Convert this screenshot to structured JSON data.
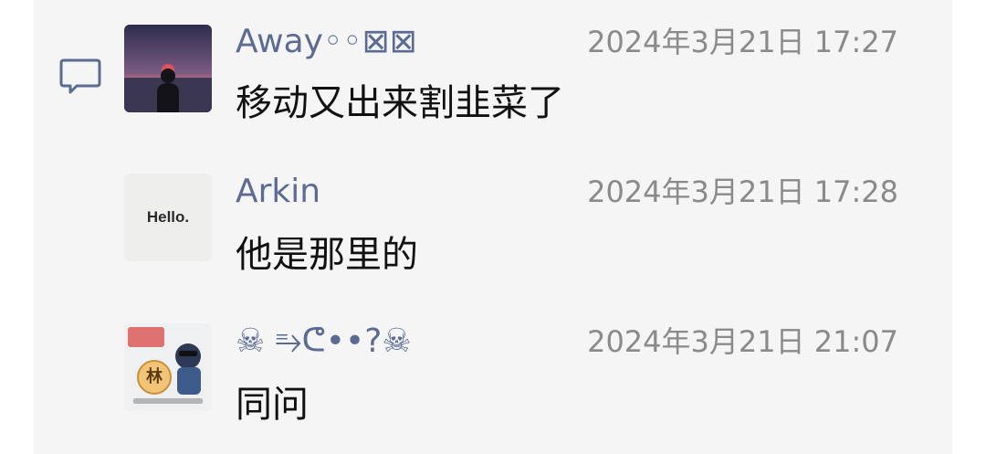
{
  "comments": [
    {
      "author": "Away◦◦⊠⊠",
      "timestamp": "2024年3月21日 17:27",
      "text": "移动又出来割韭菜了"
    },
    {
      "author": "Arkin",
      "timestamp": "2024年3月21日 17:28",
      "text": "他是那里的",
      "avatar_text": "Hello."
    },
    {
      "author": "☠ ⥱ᕦ••?☠",
      "timestamp": "2024年3月21日 21:07",
      "text": "同问",
      "avatar_text": "林"
    }
  ],
  "colors": {
    "author": "#5b6b92",
    "timestamp": "#8a8a8a",
    "message": "#111111",
    "panel_bg": "#f5f5f5",
    "icon": "#5b6b92"
  },
  "icons": {
    "comment_indicator": "comment-icon"
  }
}
